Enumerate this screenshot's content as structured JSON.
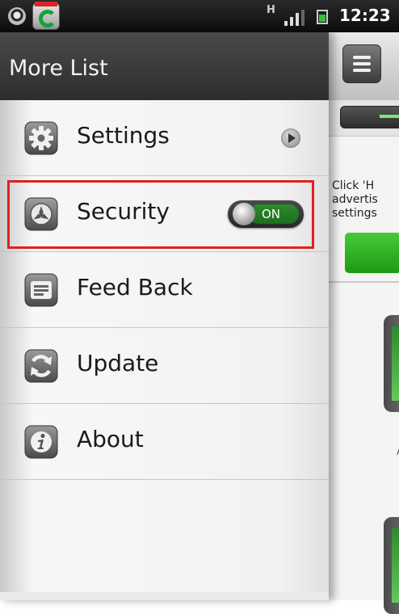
{
  "status_bar": {
    "time": "12:23",
    "network_indicator": "H",
    "icons": [
      "notification-icon",
      "app-icon",
      "signal-icon",
      "battery-icon"
    ]
  },
  "drawer": {
    "title": "More List",
    "items": [
      {
        "label": "Settings",
        "icon": "gear-icon",
        "accessory": "chevron"
      },
      {
        "label": "Security",
        "icon": "shield-icon",
        "accessory": "toggle",
        "toggle_label": "ON",
        "toggle_on": true
      },
      {
        "label": "Feed Back",
        "icon": "feedback-icon"
      },
      {
        "label": "Update",
        "icon": "refresh-icon"
      },
      {
        "label": "About",
        "icon": "info-icon"
      }
    ],
    "highlighted_item": "Security"
  },
  "main": {
    "description_lines": [
      "Click 'H",
      "advertis",
      "settings"
    ],
    "tile_label": "A"
  },
  "colors": {
    "header_bg": "#3a3a3a",
    "highlight_border": "#e02020",
    "toggle_on": "#2c8a2c",
    "accent_green": "#33b22a"
  }
}
